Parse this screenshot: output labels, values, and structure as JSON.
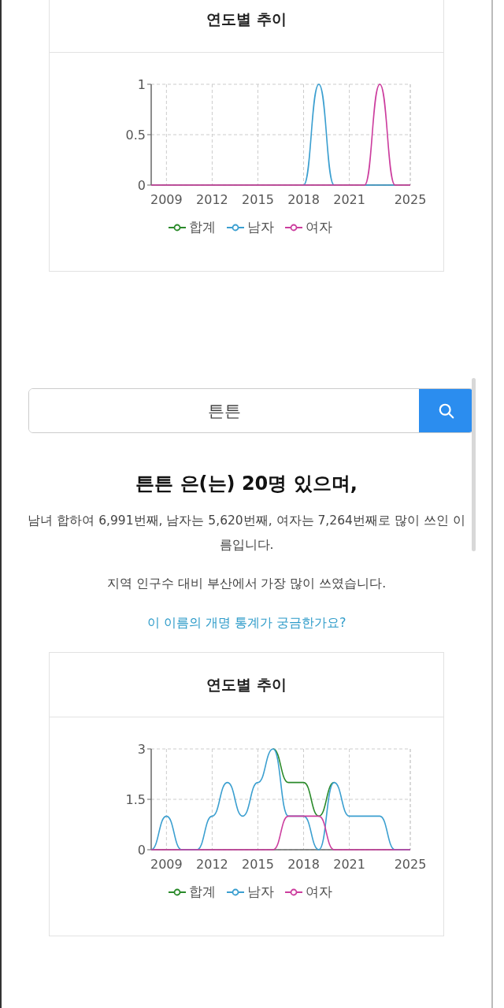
{
  "top_card": {
    "title": "연도별 추이",
    "chart_data": {
      "type": "line",
      "x": [
        2008,
        2009,
        2010,
        2011,
        2012,
        2013,
        2014,
        2015,
        2016,
        2017,
        2018,
        2019,
        2020,
        2021,
        2022,
        2023,
        2024,
        2025
      ],
      "xlim": [
        2008,
        2025
      ],
      "ylim": [
        0,
        1
      ],
      "xticks": [
        2009,
        2012,
        2015,
        2018,
        2021,
        2025
      ],
      "yticks": [
        0,
        0.5,
        1
      ],
      "grid": true,
      "series": [
        {
          "name": "합계",
          "color": "#2a8a2a",
          "values": [
            null,
            null,
            null,
            null,
            null,
            null,
            null,
            null,
            null,
            null,
            null,
            null,
            null,
            null,
            null,
            null,
            null,
            null
          ]
        },
        {
          "name": "남자",
          "color": "#3b9fd0",
          "values": [
            null,
            null,
            null,
            null,
            null,
            null,
            null,
            null,
            null,
            null,
            0,
            1,
            0,
            null,
            0,
            0,
            0,
            null
          ]
        },
        {
          "name": "여자",
          "color": "#cc3d9e",
          "values": [
            0,
            0,
            0,
            0,
            0,
            0,
            0,
            0,
            0,
            0,
            0,
            0,
            0,
            0,
            0,
            1,
            0,
            0
          ]
        }
      ]
    }
  },
  "search": {
    "value": "튼튼"
  },
  "result": {
    "heading": "튼튼 은(는) 20명 있으며,",
    "summary": "남녀 합하여 6,991번째, 남자는 5,620번째, 여자는 7,264번째로 많이 쓰인 이름입니다.",
    "region": "지역 인구수 대비 부산에서 가장 많이 쓰였습니다.",
    "link": "이 이름의 개명 통계가 궁금한가요?"
  },
  "bottom_card": {
    "title": "연도별 추이",
    "chart_data": {
      "type": "line",
      "x": [
        2008,
        2009,
        2010,
        2011,
        2012,
        2013,
        2014,
        2015,
        2016,
        2017,
        2018,
        2019,
        2020,
        2021,
        2022,
        2023,
        2024,
        2025
      ],
      "xlim": [
        2008,
        2025
      ],
      "ylim": [
        0,
        3
      ],
      "xticks": [
        2009,
        2012,
        2015,
        2018,
        2021,
        2025
      ],
      "yticks": [
        0,
        1.5,
        3
      ],
      "grid": true,
      "series": [
        {
          "name": "합계",
          "color": "#2a8a2a",
          "values": [
            null,
            null,
            null,
            null,
            null,
            null,
            null,
            null,
            3,
            2,
            2,
            1,
            2,
            null,
            null,
            null,
            null,
            null
          ]
        },
        {
          "name": "남자",
          "color": "#3b9fd0",
          "values": [
            0,
            1,
            0,
            0,
            1,
            2,
            1,
            2,
            3,
            1,
            1,
            0,
            2,
            1,
            1,
            1,
            0,
            0
          ]
        },
        {
          "name": "여자",
          "color": "#cc3d9e",
          "values": [
            0,
            0,
            0,
            0,
            0,
            0,
            0,
            0,
            0,
            1,
            1,
            1,
            0,
            0,
            0,
            0,
            0,
            0
          ]
        }
      ]
    }
  }
}
